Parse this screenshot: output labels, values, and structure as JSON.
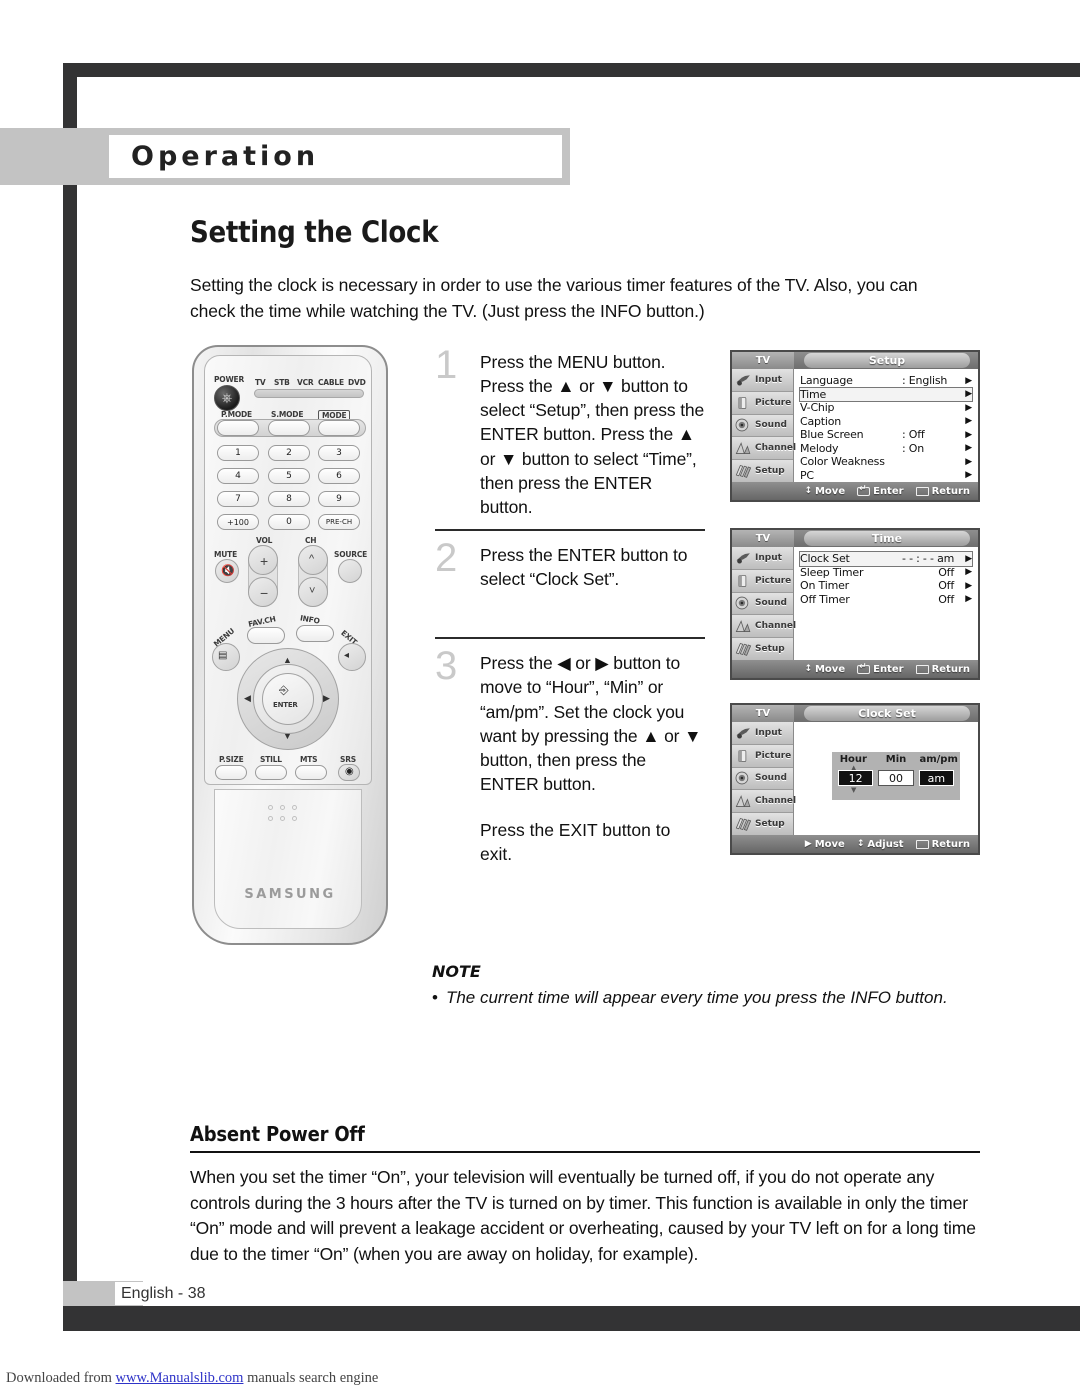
{
  "banner": {
    "section_label": "Operation"
  },
  "page": {
    "title": "Setting the Clock",
    "intro": "Setting the clock is necessary in order to use the various timer features of the TV. Also, you can check the time while watching the TV. (Just press the INFO button.)"
  },
  "steps": [
    {
      "number": "1",
      "text": "Press the MENU button. Press the ▲ or ▼ button to select “Setup”, then press the ENTER button. Press the ▲ or ▼ button to select “Time”, then press the ENTER button."
    },
    {
      "number": "2",
      "text": "Press the ENTER button to select “Clock Set”."
    },
    {
      "number": "3",
      "text": "Press the ◀ or ▶ button to move to “Hour”, “Min” or “am/pm”. Set the clock you want by pressing the ▲ or ▼ button, then press the ENTER button."
    }
  ],
  "exit_line": "Press the EXIT button to exit.",
  "osd": {
    "sidebar": [
      {
        "label": "Input",
        "icon": "input-icon"
      },
      {
        "label": "Picture",
        "icon": "picture-icon"
      },
      {
        "label": "Sound",
        "icon": "sound-icon"
      },
      {
        "label": "Channel",
        "icon": "channel-icon"
      },
      {
        "label": "Setup",
        "icon": "setup-icon"
      }
    ],
    "tv_tab": "TV",
    "menus": [
      {
        "title": "Setup",
        "rows": [
          {
            "label": "Language",
            "value": ": English",
            "arrow": "▶",
            "selected": false
          },
          {
            "label": "Time",
            "value": "",
            "arrow": "▶",
            "selected": true
          },
          {
            "label": "V-Chip",
            "value": "",
            "arrow": "▶",
            "selected": false
          },
          {
            "label": "Caption",
            "value": "",
            "arrow": "▶",
            "selected": false
          },
          {
            "label": "Blue Screen",
            "value": ": Off",
            "arrow": "▶",
            "selected": false
          },
          {
            "label": "Melody",
            "value": ": On",
            "arrow": "▶",
            "selected": false
          },
          {
            "label": "Color Weakness",
            "value": "",
            "arrow": "▶",
            "selected": false
          },
          {
            "label": "PC",
            "value": "",
            "arrow": "▶",
            "selected": false
          }
        ],
        "nav": [
          {
            "glyph": "↕",
            "label": "Move"
          },
          {
            "glyph": "enter",
            "label": "Enter"
          },
          {
            "glyph": "box",
            "label": "Return"
          }
        ]
      },
      {
        "title": "Time",
        "rows": [
          {
            "label": "Clock Set",
            "value": "- - : - -   am",
            "arrow": "▶",
            "selected": true
          },
          {
            "label": "Sleep Timer",
            "value": "Off",
            "arrow": "▶",
            "selected": false
          },
          {
            "label": "On Timer",
            "value": "Off",
            "arrow": "▶",
            "selected": false
          },
          {
            "label": "Off Timer",
            "value": "Off",
            "arrow": "▶",
            "selected": false
          }
        ],
        "nav": [
          {
            "glyph": "↕",
            "label": "Move"
          },
          {
            "glyph": "enter",
            "label": "Enter"
          },
          {
            "glyph": "box",
            "label": "Return"
          }
        ]
      },
      {
        "title": "Clock Set",
        "clock_set": {
          "headers": [
            "Hour",
            "Min",
            "am/pm"
          ],
          "values": [
            "12",
            "00",
            "am"
          ]
        },
        "nav": [
          {
            "glyph": "▶",
            "label": "Move"
          },
          {
            "glyph": "↕",
            "label": "Adjust"
          },
          {
            "glyph": "box",
            "label": "Return"
          }
        ]
      }
    ]
  },
  "note": {
    "title": "NOTE",
    "items": [
      "The current time will appear every time you press the INFO button."
    ]
  },
  "absent_power_off": {
    "title": "Absent Power Off",
    "body": "When you set the timer “On”, your television will eventually be turned off, if you do not operate any controls during the 3 hours after the TV is turned on by timer. This function is available in only the timer “On” mode and will prevent a leakage accident or overheating, caused by your TV left on for a long time due to the timer “On” (when you are away on holiday, for example)."
  },
  "footer": {
    "page_label": "English - 38"
  },
  "download_bar": {
    "prefix": "Downloaded from ",
    "link": "www.Manualslib.com",
    "suffix": " manuals search engine"
  },
  "remote": {
    "brand": "SAMSUNG",
    "power_label": "POWER",
    "device_labels": [
      "TV",
      "STB",
      "VCR",
      "CABLE",
      "DVD"
    ],
    "mode_row": [
      "P.MODE",
      "S.MODE",
      "MODE"
    ],
    "keypad": [
      "1",
      "2",
      "3",
      "4",
      "5",
      "6",
      "7",
      "8",
      "9",
      "+100",
      "0",
      "PRE-CH"
    ],
    "vol_label": "VOL",
    "ch_label": "CH",
    "mute_label": "MUTE",
    "source_label": "SOURCE",
    "fav_label": "FAV.CH",
    "info_label": "INFO",
    "menu_label": "MENU",
    "exit_label": "EXIT",
    "enter_label": "ENTER",
    "bottom_row": [
      "P.SIZE",
      "STILL",
      "MTS",
      "SRS"
    ]
  }
}
